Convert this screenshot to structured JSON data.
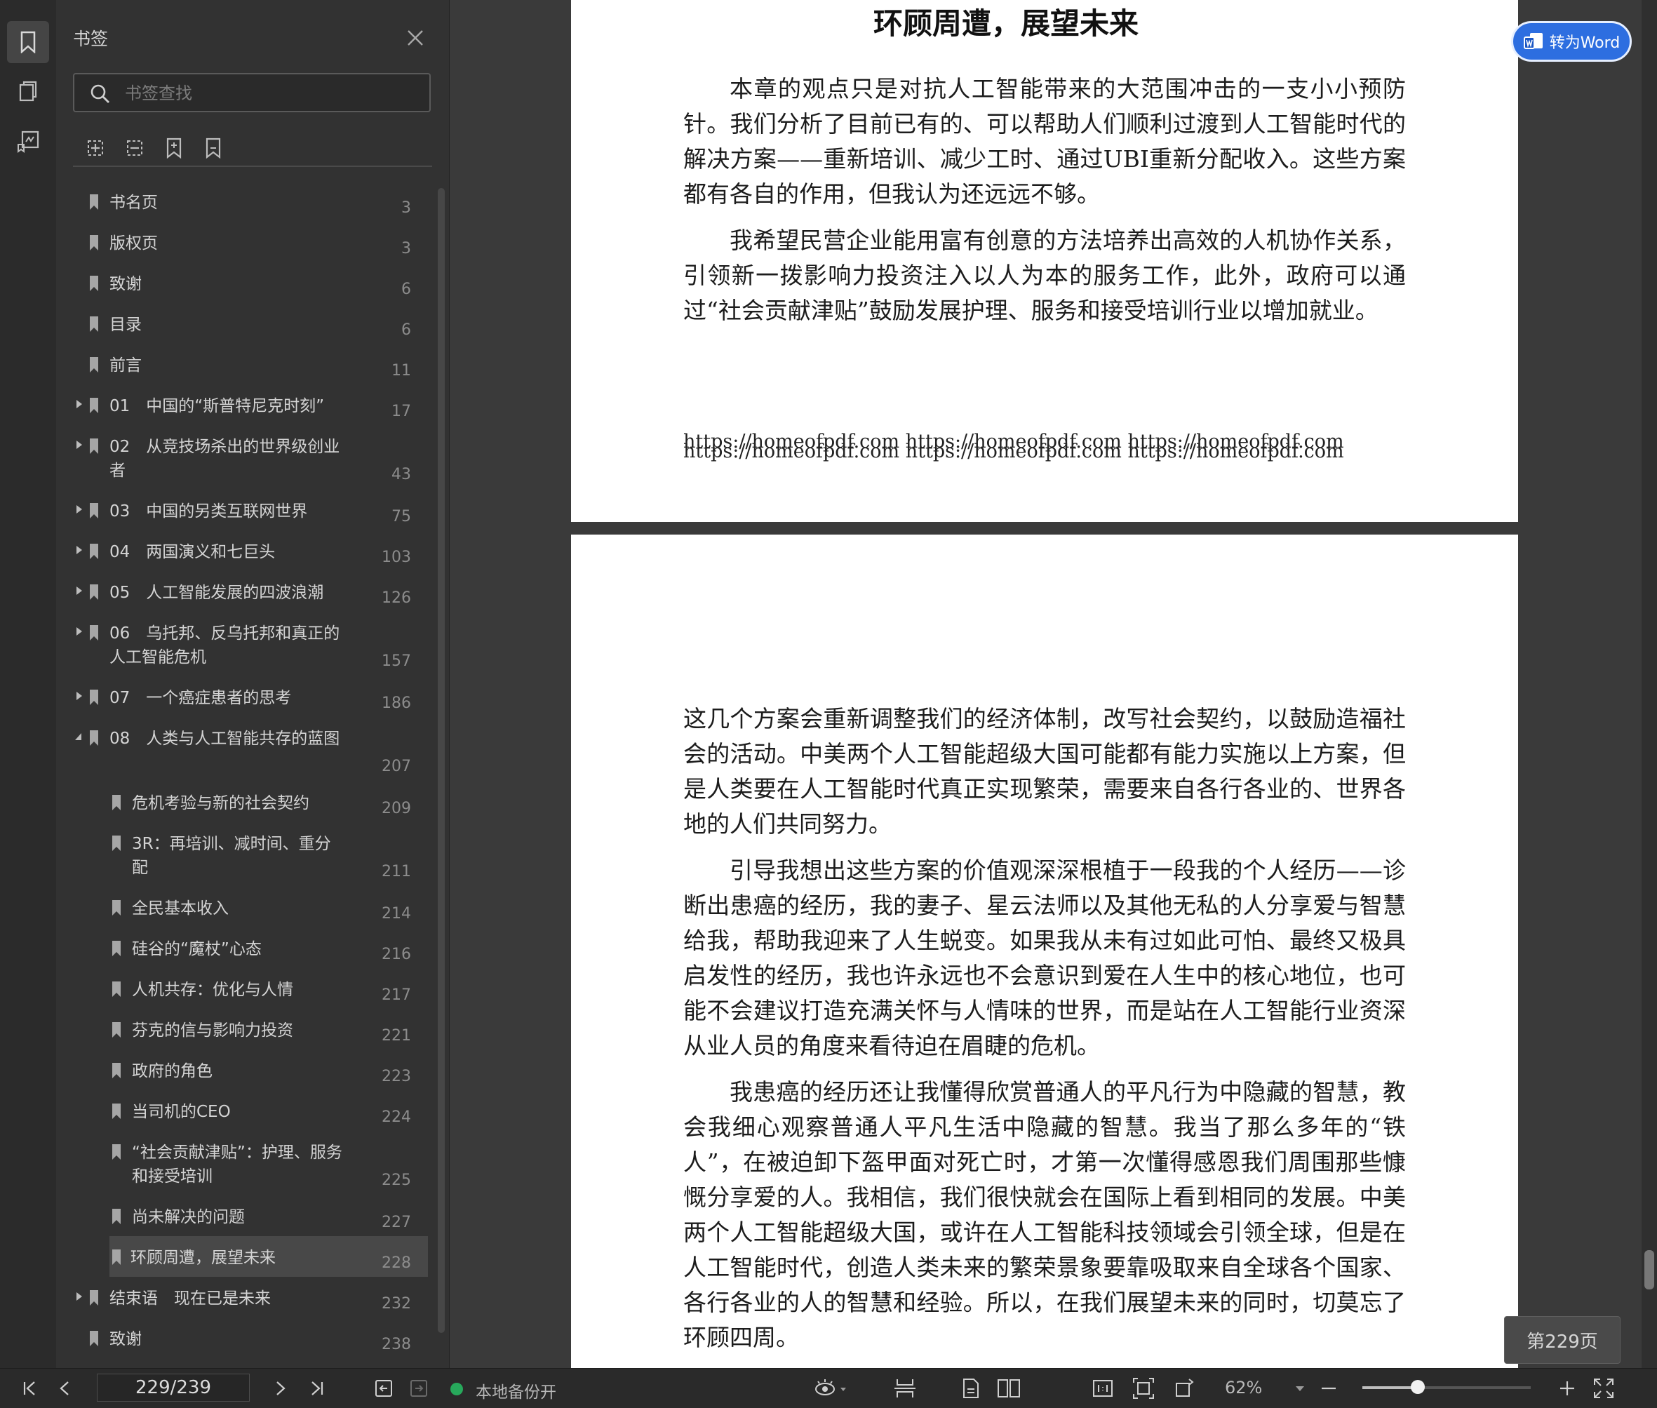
{
  "panel": {
    "title": "书签",
    "search_placeholder": "书签查找"
  },
  "bookmarks": [
    {
      "label": "书名页",
      "page": "3",
      "level": 0,
      "expandable": false
    },
    {
      "label": "版权页",
      "page": "3",
      "level": 0,
      "expandable": false
    },
    {
      "label": "致谢",
      "page": "6",
      "level": 0,
      "expandable": false
    },
    {
      "label": "目录",
      "page": "6",
      "level": 0,
      "expandable": false
    },
    {
      "label": "前言",
      "page": "11",
      "level": 0,
      "expandable": false
    },
    {
      "label": "01　中国的“斯普特尼克时刻”",
      "page": "17",
      "level": 0,
      "expandable": true
    },
    {
      "label": "02　从竞技场杀出的世界级创业者",
      "page": "43",
      "level": 0,
      "expandable": true,
      "tall": true
    },
    {
      "label": "03　中国的另类互联网世界",
      "page": "75",
      "level": 0,
      "expandable": true
    },
    {
      "label": "04　两国演义和七巨头",
      "page": "103",
      "level": 0,
      "expandable": true
    },
    {
      "label": "05　人工智能发展的四波浪潮",
      "page": "126",
      "level": 0,
      "expandable": true
    },
    {
      "label": "06　乌托邦、反乌托邦和真正的人工智能危机",
      "page": "157",
      "level": 0,
      "expandable": true,
      "tall": true
    },
    {
      "label": "07　一个癌症患者的思考",
      "page": "186",
      "level": 0,
      "expandable": true
    },
    {
      "label": "08　人类与人工智能共存的蓝图",
      "page": "207",
      "level": 0,
      "expandable": true,
      "expanded": true,
      "tall": true
    },
    {
      "label": "危机考验与新的社会契约",
      "page": "209",
      "level": 1
    },
    {
      "label": "3R：再培训、减时间、重分配",
      "page": "211",
      "level": 1,
      "tall": true
    },
    {
      "label": "全民基本收入",
      "page": "214",
      "level": 1
    },
    {
      "label": "硅谷的“魔杖”心态",
      "page": "216",
      "level": 1
    },
    {
      "label": "人机共存：优化与人情",
      "page": "217",
      "level": 1
    },
    {
      "label": "芬克的信与影响力投资",
      "page": "221",
      "level": 1
    },
    {
      "label": "政府的角色",
      "page": "223",
      "level": 1
    },
    {
      "label": "当司机的CEO",
      "page": "224",
      "level": 1
    },
    {
      "label": "“社会贡献津贴”：护理、服务和接受培训",
      "page": "225",
      "level": 1,
      "tall": true
    },
    {
      "label": "尚未解决的问题",
      "page": "227",
      "level": 1
    },
    {
      "label": "环顾周遭，展望未来",
      "page": "228",
      "level": 1,
      "selected": true
    },
    {
      "label": "结束语　现在已是未来",
      "page": "232",
      "level": 0,
      "expandable": true
    },
    {
      "label": "致谢",
      "page": "238",
      "level": 0,
      "expandable": false
    }
  ],
  "document": {
    "page1": {
      "heading": "环顾周遭，展望未来",
      "paragraphs": [
        "本章的观点只是对抗人工智能带来的大范围冲击的一支小小预防针。我们分析了目前已有的、可以帮助人们顺利过渡到人工智能时代的解决方案——重新培训、减少工时、通过UBI重新分配收入。这些方案都有各自的作用，但我认为还远远不够。",
        "我希望民营企业能用富有创意的方法培养出高效的人机协作关系，引领新一拨影响力投资注入以人为本的服务工作，此外，政府可以通过“社会贡献津贴”鼓励发展护理、服务和接受培训行业以增加就业。"
      ],
      "watermark_line1": "https://homeofpdf.com https://homeofpdf.com https://homeofpdf.com",
      "watermark_line2": "https://homeofpdf.com https://homeofpdf.com https://homeofpdf.com"
    },
    "page2": {
      "paragraphs": [
        "这几个方案会重新调整我们的经济体制，改写社会契约，以鼓励造福社会的活动。中美两个人工智能超级大国可能都有能力实施以上方案，但是人类要在人工智能时代真正实现繁荣，需要来自各行各业的、世界各地的人们共同努力。",
        "引导我想出这些方案的价值观深深根植于一段我的个人经历——诊断出患癌的经历，我的妻子、星云法师以及其他无私的人分享爱与智慧给我，帮助我迎来了人生蜕变。如果我从未有过如此可怕、最终又极具启发性的经历，我也许永远也不会意识到爱在人生中的核心地位，也可能不会建议打造充满关怀与人情味的世界，而是站在人工智能行业资深从业人员的角度来看待迫在眉睫的危机。",
        "我患癌的经历还让我懂得欣赏普通人的平凡行为中隐藏的智慧，教会我细心观察普通人平凡生活中隐藏的智慧。我当了那么多年的“铁人”，在被迫卸下盔甲面对死亡时，才第一次懂得感恩我们周围那些慷慨分享爱的人。我相信，我们很快就会在国际上看到相同的发展。中美两个人工智能超级大国，或许在人工智能科技领域会引领全球，但是在人工智能时代，创造人类未来的繁荣景象要靠吸取来自全球各个国家、各行各业的人的智慧和经验。所以，在我们展望未来的同时，切莫忘了环顾四周。"
      ]
    }
  },
  "word_button": {
    "label": "转为Word"
  },
  "page_badge": "第229页",
  "toolbar": {
    "page_value": "229/239",
    "backup_label": "本地备份开",
    "zoom": "62%",
    "zoom_fraction": 0.33
  },
  "colors": {
    "accent": "#2d6ee0",
    "backup_on": "#27a85b",
    "panel_bg": "#323232",
    "selected_row": "#484848"
  },
  "icons": [
    "bookmark-icon",
    "thumbnail-icon",
    "annotation-icon",
    "close-icon",
    "search-icon",
    "expand-all-icon",
    "collapse-all-icon",
    "add-bookmark-icon",
    "bookmark-outline-icon",
    "first-page-icon",
    "prev-page-icon",
    "next-page-icon",
    "last-page-icon",
    "back-icon",
    "forward-icon",
    "eye-protect-icon",
    "scroll-mode-icon",
    "single-page-icon",
    "double-page-icon",
    "actual-size-icon",
    "fit-page-icon",
    "rotate-icon",
    "zoom-out-icon",
    "zoom-in-icon",
    "fullscreen-icon",
    "word-convert-icon"
  ]
}
